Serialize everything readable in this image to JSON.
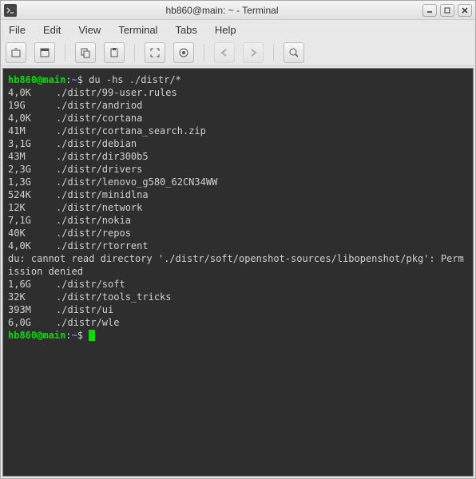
{
  "window": {
    "title": "hb860@main: ~ - Terminal"
  },
  "menubar": {
    "file": "File",
    "edit": "Edit",
    "view": "View",
    "terminal": "Terminal",
    "tabs": "Tabs",
    "help": "Help"
  },
  "prompt": {
    "user_host": "hb860@main",
    "colon": ":",
    "path": "~",
    "sigil": "$"
  },
  "command": "du -hs ./distr/*",
  "output_rows": [
    {
      "size": "4,0K",
      "path": "./distr/99-user.rules"
    },
    {
      "size": "19G",
      "path": "./distr/andriod"
    },
    {
      "size": "4,0K",
      "path": "./distr/cortana"
    },
    {
      "size": "41M",
      "path": "./distr/cortana_search.zip"
    },
    {
      "size": "3,1G",
      "path": "./distr/debian"
    },
    {
      "size": "43M",
      "path": "./distr/dir300b5"
    },
    {
      "size": "2,3G",
      "path": "./distr/drivers"
    },
    {
      "size": "1,3G",
      "path": "./distr/lenovo_g580_62CN34WW"
    },
    {
      "size": "524K",
      "path": "./distr/minidlna"
    },
    {
      "size": "12K",
      "path": "./distr/network"
    },
    {
      "size": "7,1G",
      "path": "./distr/nokia"
    },
    {
      "size": "40K",
      "path": "./distr/repos"
    },
    {
      "size": "4,0K",
      "path": "./distr/rtorrent"
    }
  ],
  "error_line": "du: cannot read directory './distr/soft/openshot-sources/libopenshot/pkg': Permission denied",
  "output_rows2": [
    {
      "size": "1,6G",
      "path": "./distr/soft"
    },
    {
      "size": "32K",
      "path": "./distr/tools_tricks"
    },
    {
      "size": "393M",
      "path": "./distr/ui"
    },
    {
      "size": "6,0G",
      "path": "./distr/wle"
    }
  ]
}
